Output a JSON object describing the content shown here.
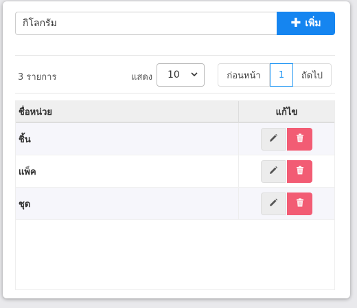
{
  "form": {
    "unit_input_value": "กิโลกรัม",
    "add_button_label": "เพิ่ม",
    "add_button_icon": "plus-icon",
    "accent_color": "#1585f0"
  },
  "toolbar": {
    "record_count": "3 รายการ",
    "show_label": "แสดง",
    "page_size": "10",
    "prev_label": "ก่อนหน้า",
    "current_page": "1",
    "next_label": "ถัดไป"
  },
  "table": {
    "headers": {
      "name": "ชื่อหน่วย",
      "edit": "แก้ไข"
    },
    "rows": [
      {
        "name": "ชิ้น"
      },
      {
        "name": "แพ็ค"
      },
      {
        "name": "ชุด"
      }
    ],
    "edit_icon": "pencil-icon",
    "delete_icon": "trash-icon",
    "delete_color": "#f25c74"
  }
}
